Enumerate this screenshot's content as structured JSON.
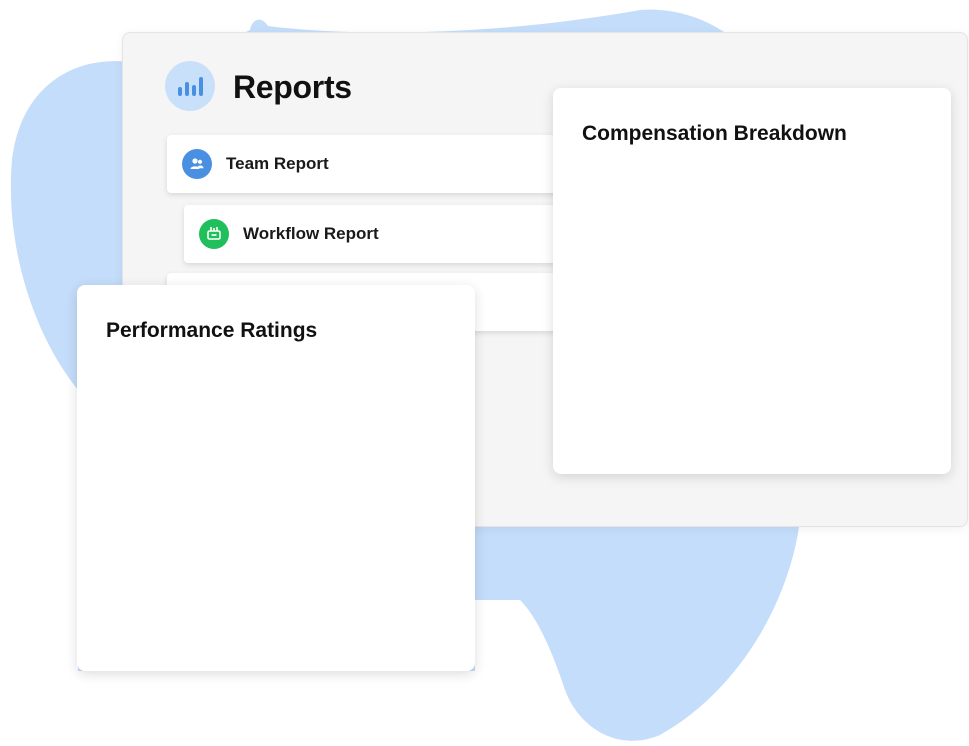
{
  "colors": {
    "blob": "#c4ddfa",
    "accent_blue": "#4a90e2",
    "accent_green": "#1fbf5c",
    "panel_bg": "#f5f5f5"
  },
  "reports": {
    "title": "Reports",
    "icon": "bar-chart-icon",
    "items": [
      {
        "label": "Team Report",
        "icon": "team-icon"
      },
      {
        "label": "Workflow Report",
        "icon": "workflow-icon"
      },
      {
        "label": ""
      }
    ]
  },
  "cards": {
    "compensation": {
      "title": "Compensation Breakdown"
    },
    "performance": {
      "title": "Performance Ratings"
    }
  }
}
